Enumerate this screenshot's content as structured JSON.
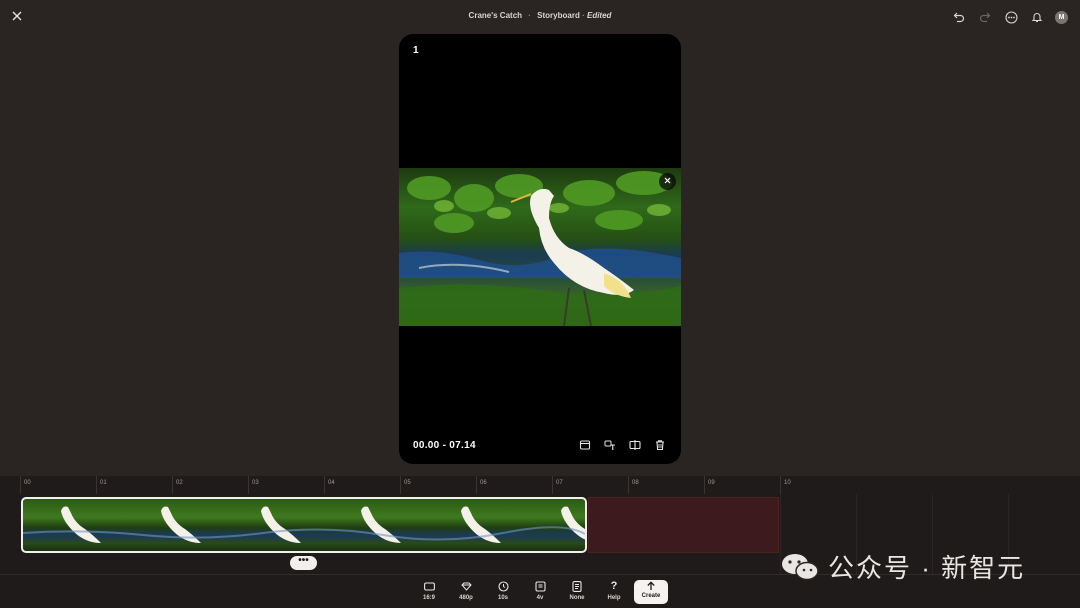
{
  "header": {
    "project_name": "Crane's Catch",
    "separator": "·",
    "view_name": "Storyboard",
    "status": "Edited",
    "avatar_initial": "M"
  },
  "preview": {
    "card_index": "1",
    "time_range": "00.00 - 07.14"
  },
  "timeline": {
    "ticks": [
      "00",
      "01",
      "02",
      "03",
      "04",
      "05",
      "06",
      "07",
      "08",
      "09",
      "10"
    ]
  },
  "toolbar": {
    "aspect_label": "16:9",
    "resolution_label": "480p",
    "duration_label": "10s",
    "variations_label": "4v",
    "preset_label": "None",
    "help_label": "Help",
    "create_label": "Create"
  },
  "watermark": {
    "text": "公众号 · 新智元"
  },
  "icons": {
    "close": "close-icon",
    "undo": "undo-icon",
    "redo": "redo-icon",
    "more": "more-icon",
    "notifications": "bell-icon"
  },
  "colors": {
    "background": "#2a2523",
    "empty_region": "#3c1a1e",
    "create_button": "#f5f2ef"
  }
}
